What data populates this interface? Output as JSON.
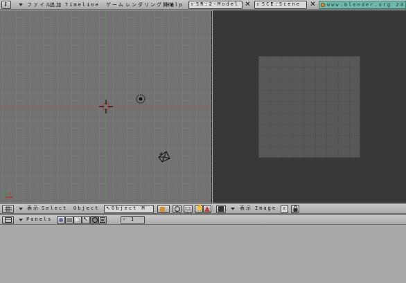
{
  "top_menu": {
    "items": [
      "ファイル",
      "追加",
      "Timeline",
      "ゲーム",
      "レンダリング開始",
      "Help"
    ],
    "screen_field": "SR:2-Model",
    "scene_field": "SCE:Scene",
    "url": "www.blender.org 24"
  },
  "viewport3d": {
    "menus": [
      "表示",
      "Select",
      "Object"
    ],
    "mode": "Object M"
  },
  "image_editor": {
    "menus": [
      "表示",
      "Image"
    ]
  },
  "buttons_window": {
    "label": "Panels",
    "frame": "1"
  },
  "colors": {
    "viewport_bg": "#727272",
    "image_bg": "#383838",
    "url_bg": "#6db8a8"
  }
}
